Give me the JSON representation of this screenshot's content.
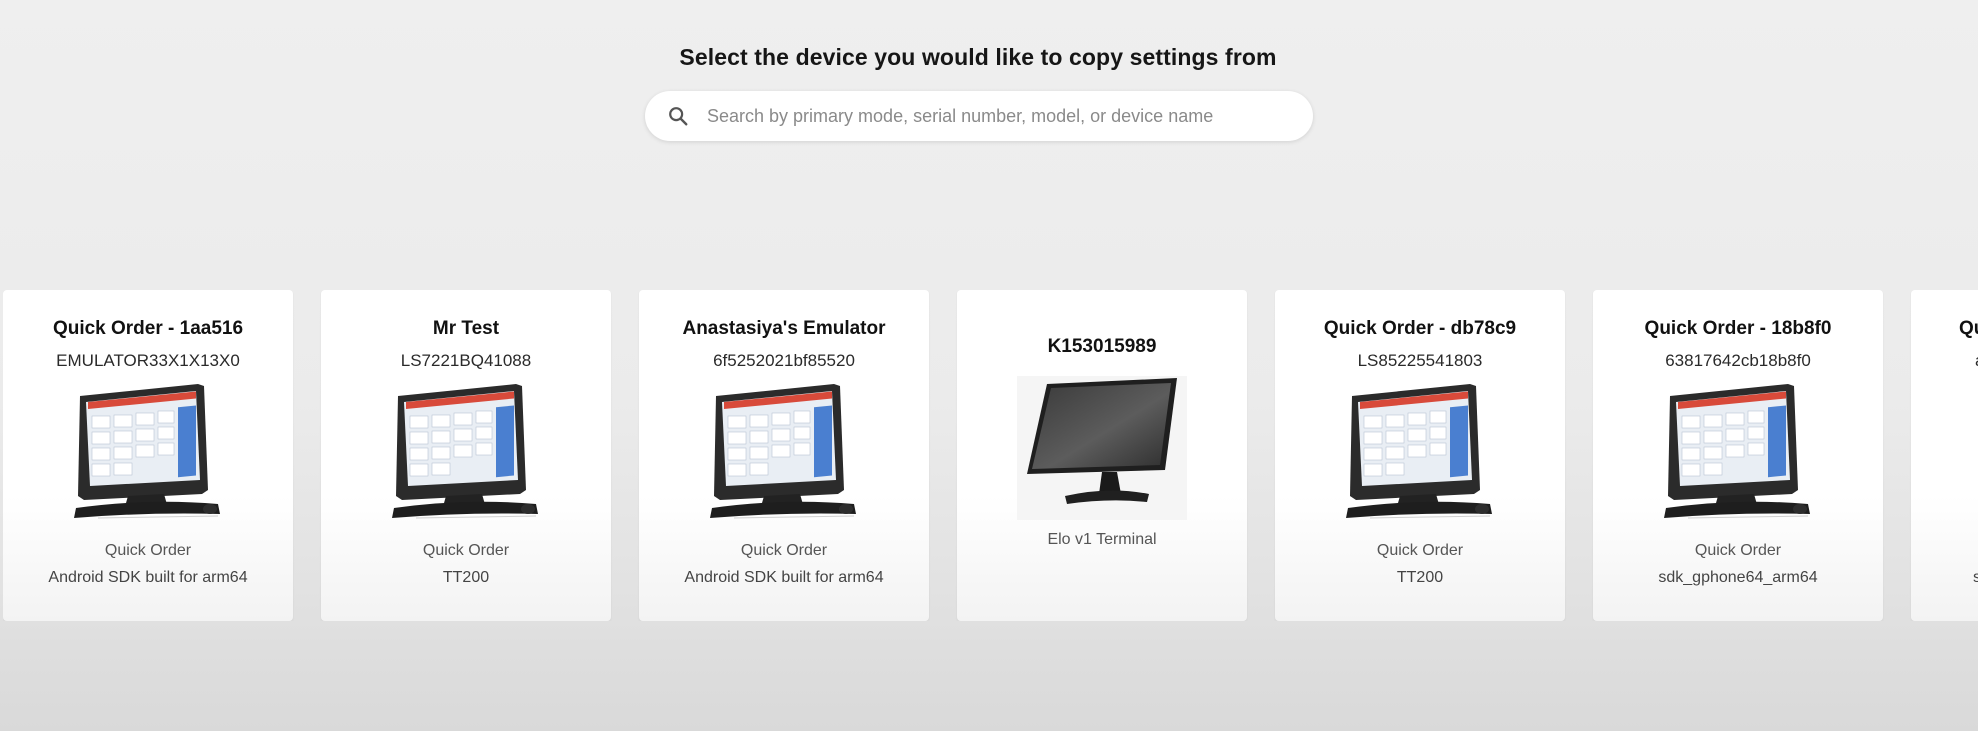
{
  "header": {
    "title": "Select the device you would like to copy settings from"
  },
  "search": {
    "placeholder": "Search by primary mode, serial number, model, or device name",
    "value": "",
    "icon": "search-icon"
  },
  "devices": [
    {
      "name": "Quick Order - 1aa516",
      "serial": "EMULATOR33X1X13X0",
      "mode": "Quick Order",
      "model": "Android SDK built for arm64",
      "image": "pos-terminal-icon"
    },
    {
      "name": "Mr Test",
      "serial": "LS7221BQ41088",
      "mode": "Quick Order",
      "model": "TT200",
      "image": "pos-terminal-icon"
    },
    {
      "name": "Anastasiya's Emulator",
      "serial": "6f5252021bf85520",
      "mode": "Quick Order",
      "model": "Android SDK built for arm64",
      "image": "pos-terminal-icon"
    },
    {
      "name": "K153015989",
      "serial": "",
      "mode": "",
      "model": "Elo v1 Terminal",
      "image": "elo-terminal-icon"
    },
    {
      "name": "Quick Order - db78c9",
      "serial": "LS85225541803",
      "mode": "Quick Order",
      "model": "TT200",
      "image": "pos-terminal-icon"
    },
    {
      "name": "Quick Order - 18b8f0",
      "serial": "63817642cb18b8f0",
      "mode": "Quick Order",
      "model": "sdk_gphone64_arm64",
      "image": "pos-terminal-icon"
    },
    {
      "name": "Qu",
      "serial": "a",
      "mode": "",
      "model": "s",
      "image": ""
    }
  ]
}
